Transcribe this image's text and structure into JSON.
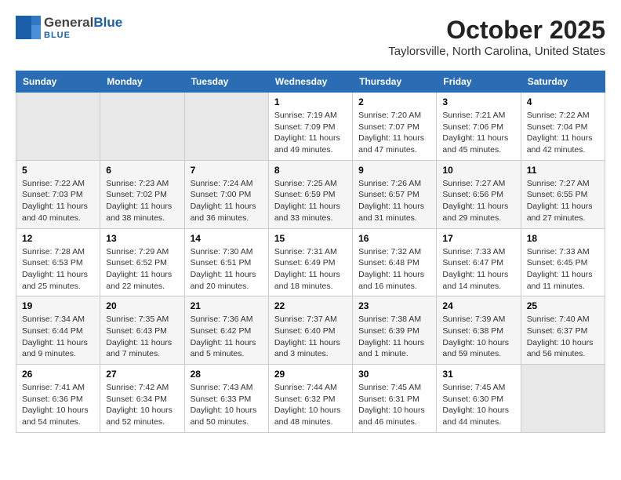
{
  "header": {
    "logo_general": "General",
    "logo_blue": "Blue",
    "title": "October 2025",
    "subtitle": "Taylorsville, North Carolina, United States"
  },
  "weekdays": [
    "Sunday",
    "Monday",
    "Tuesday",
    "Wednesday",
    "Thursday",
    "Friday",
    "Saturday"
  ],
  "weeks": [
    [
      {
        "day": "",
        "empty": true
      },
      {
        "day": "",
        "empty": true
      },
      {
        "day": "",
        "empty": true
      },
      {
        "day": "1",
        "sunrise": "Sunrise: 7:19 AM",
        "sunset": "Sunset: 7:09 PM",
        "daylight": "Daylight: 11 hours and 49 minutes."
      },
      {
        "day": "2",
        "sunrise": "Sunrise: 7:20 AM",
        "sunset": "Sunset: 7:07 PM",
        "daylight": "Daylight: 11 hours and 47 minutes."
      },
      {
        "day": "3",
        "sunrise": "Sunrise: 7:21 AM",
        "sunset": "Sunset: 7:06 PM",
        "daylight": "Daylight: 11 hours and 45 minutes."
      },
      {
        "day": "4",
        "sunrise": "Sunrise: 7:22 AM",
        "sunset": "Sunset: 7:04 PM",
        "daylight": "Daylight: 11 hours and 42 minutes."
      }
    ],
    [
      {
        "day": "5",
        "sunrise": "Sunrise: 7:22 AM",
        "sunset": "Sunset: 7:03 PM",
        "daylight": "Daylight: 11 hours and 40 minutes."
      },
      {
        "day": "6",
        "sunrise": "Sunrise: 7:23 AM",
        "sunset": "Sunset: 7:02 PM",
        "daylight": "Daylight: 11 hours and 38 minutes."
      },
      {
        "day": "7",
        "sunrise": "Sunrise: 7:24 AM",
        "sunset": "Sunset: 7:00 PM",
        "daylight": "Daylight: 11 hours and 36 minutes."
      },
      {
        "day": "8",
        "sunrise": "Sunrise: 7:25 AM",
        "sunset": "Sunset: 6:59 PM",
        "daylight": "Daylight: 11 hours and 33 minutes."
      },
      {
        "day": "9",
        "sunrise": "Sunrise: 7:26 AM",
        "sunset": "Sunset: 6:57 PM",
        "daylight": "Daylight: 11 hours and 31 minutes."
      },
      {
        "day": "10",
        "sunrise": "Sunrise: 7:27 AM",
        "sunset": "Sunset: 6:56 PM",
        "daylight": "Daylight: 11 hours and 29 minutes."
      },
      {
        "day": "11",
        "sunrise": "Sunrise: 7:27 AM",
        "sunset": "Sunset: 6:55 PM",
        "daylight": "Daylight: 11 hours and 27 minutes."
      }
    ],
    [
      {
        "day": "12",
        "sunrise": "Sunrise: 7:28 AM",
        "sunset": "Sunset: 6:53 PM",
        "daylight": "Daylight: 11 hours and 25 minutes."
      },
      {
        "day": "13",
        "sunrise": "Sunrise: 7:29 AM",
        "sunset": "Sunset: 6:52 PM",
        "daylight": "Daylight: 11 hours and 22 minutes."
      },
      {
        "day": "14",
        "sunrise": "Sunrise: 7:30 AM",
        "sunset": "Sunset: 6:51 PM",
        "daylight": "Daylight: 11 hours and 20 minutes."
      },
      {
        "day": "15",
        "sunrise": "Sunrise: 7:31 AM",
        "sunset": "Sunset: 6:49 PM",
        "daylight": "Daylight: 11 hours and 18 minutes."
      },
      {
        "day": "16",
        "sunrise": "Sunrise: 7:32 AM",
        "sunset": "Sunset: 6:48 PM",
        "daylight": "Daylight: 11 hours and 16 minutes."
      },
      {
        "day": "17",
        "sunrise": "Sunrise: 7:33 AM",
        "sunset": "Sunset: 6:47 PM",
        "daylight": "Daylight: 11 hours and 14 minutes."
      },
      {
        "day": "18",
        "sunrise": "Sunrise: 7:33 AM",
        "sunset": "Sunset: 6:45 PM",
        "daylight": "Daylight: 11 hours and 11 minutes."
      }
    ],
    [
      {
        "day": "19",
        "sunrise": "Sunrise: 7:34 AM",
        "sunset": "Sunset: 6:44 PM",
        "daylight": "Daylight: 11 hours and 9 minutes."
      },
      {
        "day": "20",
        "sunrise": "Sunrise: 7:35 AM",
        "sunset": "Sunset: 6:43 PM",
        "daylight": "Daylight: 11 hours and 7 minutes."
      },
      {
        "day": "21",
        "sunrise": "Sunrise: 7:36 AM",
        "sunset": "Sunset: 6:42 PM",
        "daylight": "Daylight: 11 hours and 5 minutes."
      },
      {
        "day": "22",
        "sunrise": "Sunrise: 7:37 AM",
        "sunset": "Sunset: 6:40 PM",
        "daylight": "Daylight: 11 hours and 3 minutes."
      },
      {
        "day": "23",
        "sunrise": "Sunrise: 7:38 AM",
        "sunset": "Sunset: 6:39 PM",
        "daylight": "Daylight: 11 hours and 1 minute."
      },
      {
        "day": "24",
        "sunrise": "Sunrise: 7:39 AM",
        "sunset": "Sunset: 6:38 PM",
        "daylight": "Daylight: 10 hours and 59 minutes."
      },
      {
        "day": "25",
        "sunrise": "Sunrise: 7:40 AM",
        "sunset": "Sunset: 6:37 PM",
        "daylight": "Daylight: 10 hours and 56 minutes."
      }
    ],
    [
      {
        "day": "26",
        "sunrise": "Sunrise: 7:41 AM",
        "sunset": "Sunset: 6:36 PM",
        "daylight": "Daylight: 10 hours and 54 minutes."
      },
      {
        "day": "27",
        "sunrise": "Sunrise: 7:42 AM",
        "sunset": "Sunset: 6:34 PM",
        "daylight": "Daylight: 10 hours and 52 minutes."
      },
      {
        "day": "28",
        "sunrise": "Sunrise: 7:43 AM",
        "sunset": "Sunset: 6:33 PM",
        "daylight": "Daylight: 10 hours and 50 minutes."
      },
      {
        "day": "29",
        "sunrise": "Sunrise: 7:44 AM",
        "sunset": "Sunset: 6:32 PM",
        "daylight": "Daylight: 10 hours and 48 minutes."
      },
      {
        "day": "30",
        "sunrise": "Sunrise: 7:45 AM",
        "sunset": "Sunset: 6:31 PM",
        "daylight": "Daylight: 10 hours and 46 minutes."
      },
      {
        "day": "31",
        "sunrise": "Sunrise: 7:45 AM",
        "sunset": "Sunset: 6:30 PM",
        "daylight": "Daylight: 10 hours and 44 minutes."
      },
      {
        "day": "",
        "empty": true
      }
    ]
  ]
}
